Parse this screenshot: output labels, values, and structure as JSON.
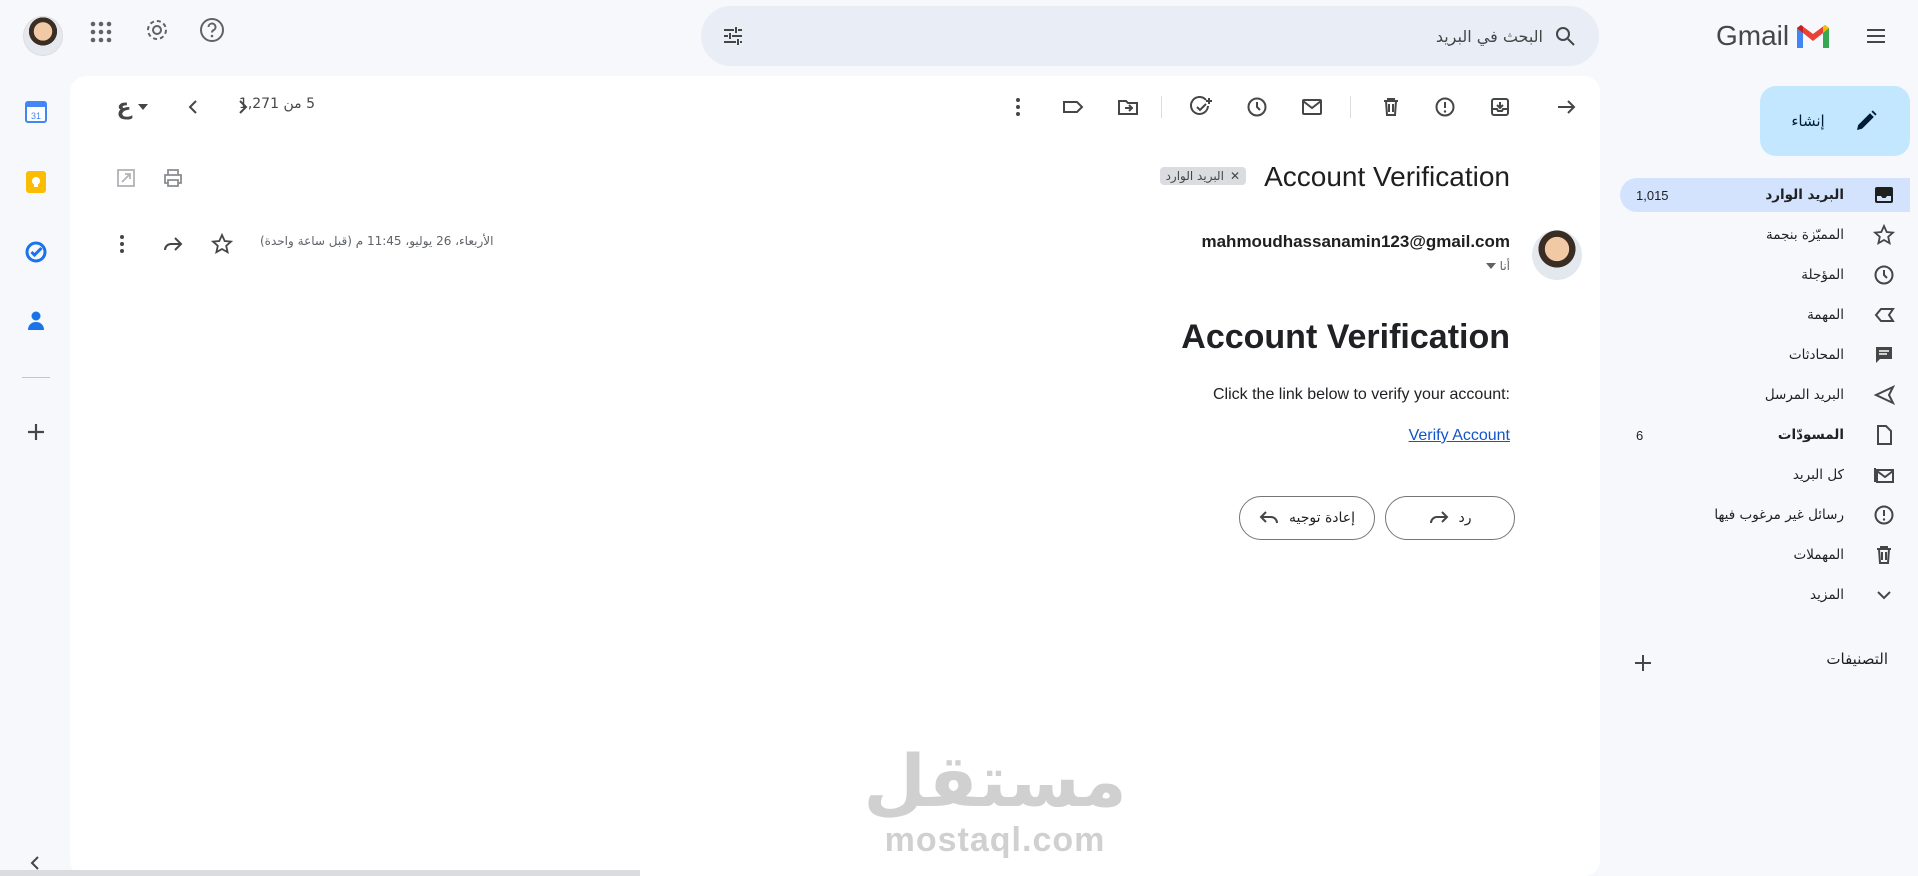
{
  "app": {
    "logo_text": "Gmail"
  },
  "search": {
    "placeholder": "البحث في البريد"
  },
  "compose": {
    "label": "إنشاء"
  },
  "nav": [
    {
      "label": "البريد الوارد",
      "count": "1,015",
      "icon": "inbox-icon",
      "active": true
    },
    {
      "label": "المميّزة بنجمة",
      "count": "",
      "icon": "star-icon"
    },
    {
      "label": "المؤجلة",
      "count": "",
      "icon": "clock-icon"
    },
    {
      "label": "المهمة",
      "count": "",
      "icon": "label-important-icon"
    },
    {
      "label": "المحادثات",
      "count": "",
      "icon": "chat-icon"
    },
    {
      "label": "البريد المرسل",
      "count": "",
      "icon": "send-icon"
    },
    {
      "label": "المسودّات",
      "count": "6",
      "icon": "draft-icon",
      "bold": true
    },
    {
      "label": "كل البريد",
      "count": "",
      "icon": "all-mail-icon"
    },
    {
      "label": "رسائل غير مرغوب فيها",
      "count": "",
      "icon": "spam-icon"
    },
    {
      "label": "المهملات",
      "count": "",
      "icon": "trash-icon"
    },
    {
      "label": "المزيد",
      "count": "",
      "icon": "chevron-down-icon"
    }
  ],
  "labels_section": {
    "title": "التصنيفات"
  },
  "toolbar": {
    "pager": "5 من 1,271",
    "input_tool": "ع"
  },
  "message": {
    "subject": "Account Verification",
    "chip": "البريد الوارد",
    "sender": "mahmoudhassanamin123@gmail.com",
    "to": "أنا",
    "date": "الأربعاء، 26 يوليو، 11:45 م (قبل ساعة واحدة)",
    "body_title": "Account Verification",
    "body_text": "Click the link below to verify your account:",
    "link_text": "Verify Account"
  },
  "actions": {
    "reply": "رد",
    "forward": "إعادة توجيه"
  },
  "watermark": {
    "arabic": "مستقل",
    "latin": "mostaql.com"
  },
  "colors": {
    "background": "#f6f8fc",
    "compose": "#c2e7ff",
    "active_nav": "#d3e3fd",
    "link": "#1155cc"
  }
}
